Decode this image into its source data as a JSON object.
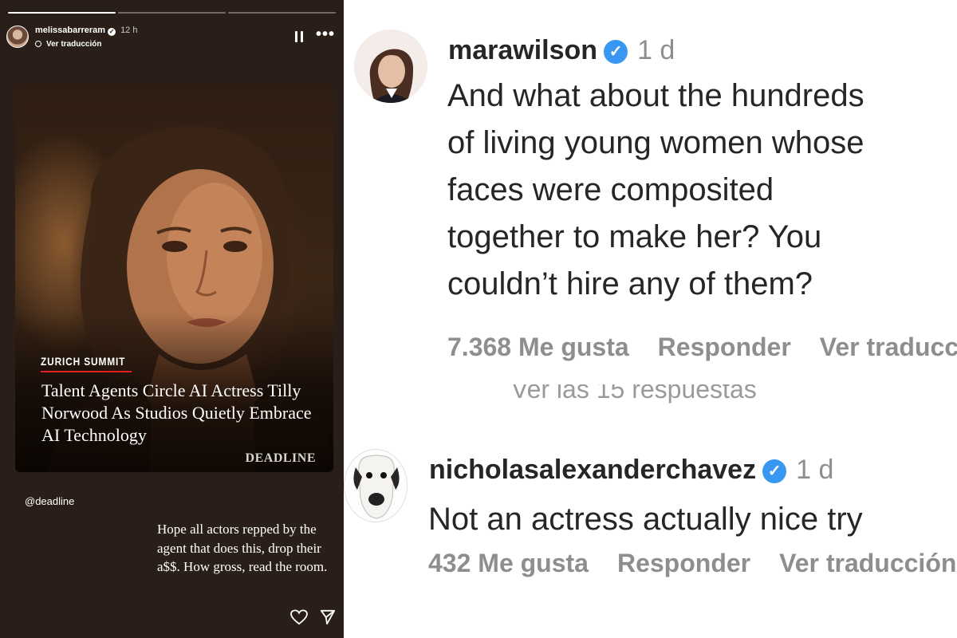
{
  "story": {
    "username": "melissabarreram",
    "time_ago": "12 h",
    "translate_label": "Ver traducción",
    "post": {
      "kicker": "ZURICH SUMMIT",
      "headline": "Talent Agents Circle AI Actress Tilly Norwood As Studios Quietly Embrace AI Technology",
      "brand": "DEADLINE"
    },
    "mention": "@deadline",
    "caption": "Hope all actors repped by the agent that does this, drop their a$$. How gross, read the room.",
    "icons": [
      "pause-icon",
      "more-icon",
      "heart-icon",
      "send-icon"
    ]
  },
  "comments": [
    {
      "username": "marawilson",
      "age": "1 d",
      "text_lines": [
        "And what about the hundreds",
        "of living young women whose",
        "faces were composited",
        "together to make her? You",
        "couldn’t hire any of them?"
      ],
      "likes": "7.368 Me gusta",
      "reply_label": "Responder",
      "translate_label": "Ver traducción",
      "replies_label": "Ver las 15 respuestas"
    },
    {
      "username": "nicholasalexanderchavez",
      "age": "1 d",
      "text_lines": [
        "Not an actress actually nice try"
      ],
      "likes": "432 Me gusta",
      "reply_label": "Responder",
      "translate_label": "Ver traducción"
    }
  ],
  "colors": {
    "verified": "#3897f0",
    "story_bg": "#291f18",
    "kicker_underline": "#e02020"
  }
}
